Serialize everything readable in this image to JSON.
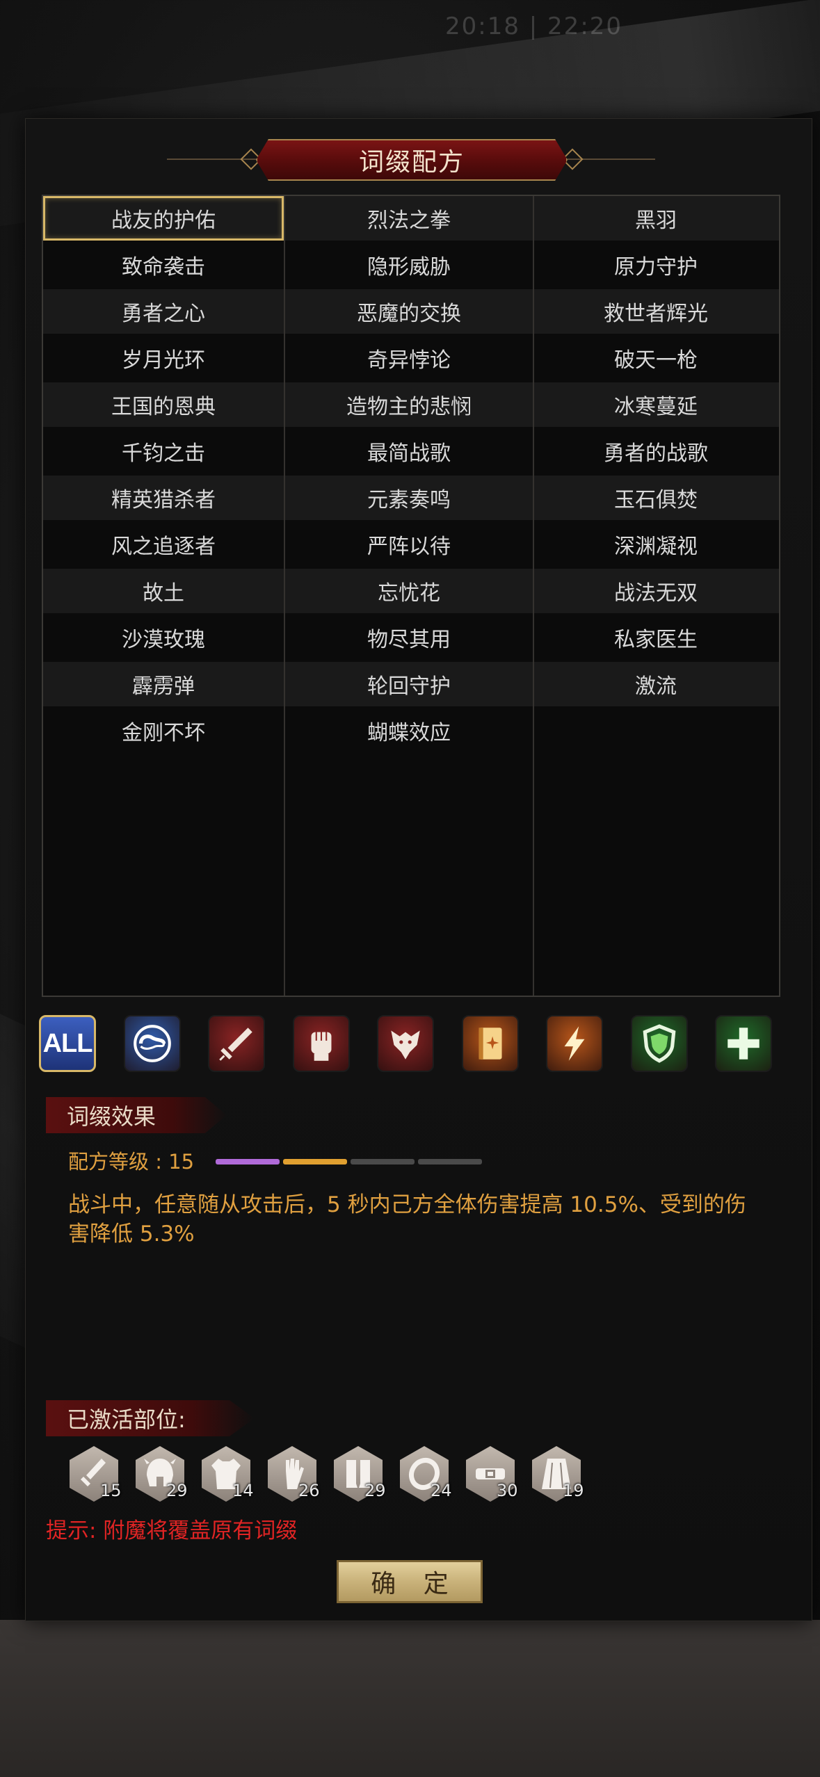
{
  "status_time": "20:18 | 22:20",
  "title": "词缀配方",
  "selected_affix": "战友的护佑",
  "affix_columns": [
    [
      "战友的护佑",
      "致命袭击",
      "勇者之心",
      "岁月光环",
      "王国的恩典",
      "千钧之击",
      "精英猎杀者",
      "风之追逐者",
      "故土",
      "沙漠玫瑰",
      "霹雳弹",
      "金刚不坏"
    ],
    [
      "烈法之拳",
      "隐形威胁",
      "恶魔的交换",
      "奇异悖论",
      "造物主的悲悯",
      "最简战歌",
      "元素奏鸣",
      "严阵以待",
      "忘忧花",
      "物尽其用",
      "轮回守护",
      "蝴蝶效应"
    ],
    [
      "黑羽",
      "原力守护",
      "救世者辉光",
      "破天一枪",
      "冰寒蔓延",
      "勇者的战歌",
      "玉石俱焚",
      "深渊凝视",
      "战法无双",
      "私家医生",
      "激流"
    ]
  ],
  "filters": [
    {
      "label": "ALL",
      "icon": "all-icon",
      "color": "#3c5fbf",
      "active": true
    },
    {
      "icon": "yin-yang-icon",
      "color": "#2f5aa8"
    },
    {
      "icon": "sword-icon",
      "color": "#8a2424"
    },
    {
      "icon": "fist-icon",
      "color": "#8a2424"
    },
    {
      "icon": "wolf-icon",
      "color": "#8a2424"
    },
    {
      "icon": "book-icon",
      "color": "#b8561a"
    },
    {
      "icon": "lightning-icon",
      "color": "#b8561a"
    },
    {
      "icon": "shield-icon",
      "color": "#1f6a2a"
    },
    {
      "icon": "plus-icon",
      "color": "#1f6a2a"
    }
  ],
  "effect": {
    "section_label": "词缀效果",
    "level_label": "配方等级 : 15",
    "level_segments": [
      "#b06ad8",
      "#e0a030",
      "#4a4a4a",
      "#4a4a4a"
    ],
    "description": "战斗中，任意随从攻击后，5 秒内己方全体伤害提高 10.5%、受到的伤害降低 5.3%"
  },
  "activated": {
    "section_label": "已激活部位:",
    "slots": [
      {
        "icon": "dagger-icon",
        "count": "15"
      },
      {
        "icon": "helmet-icon",
        "count": "29"
      },
      {
        "icon": "armor-icon",
        "count": "14"
      },
      {
        "icon": "glove-icon",
        "count": "26"
      },
      {
        "icon": "boots-icon",
        "count": "29"
      },
      {
        "icon": "ring-icon",
        "count": "24"
      },
      {
        "icon": "belt-icon",
        "count": "30"
      },
      {
        "icon": "cape-icon",
        "count": "19"
      }
    ]
  },
  "hint": "提示: 附魔将覆盖原有词缀",
  "confirm_label": "确 定"
}
